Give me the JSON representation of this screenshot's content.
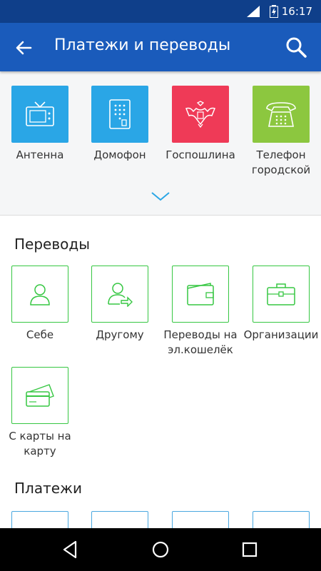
{
  "status": {
    "time": "16:17"
  },
  "appbar": {
    "title": "Платежи и переводы"
  },
  "top_tiles": [
    {
      "label": "Антенна",
      "color": "#2aa6e6"
    },
    {
      "label": "Домофон",
      "color": "#2aa6e6"
    },
    {
      "label": "Госпошлина",
      "color": "#ef3a57"
    },
    {
      "label": "Телефон городской",
      "color": "#8cc73f"
    }
  ],
  "transfers": {
    "title": "Переводы",
    "items": [
      {
        "label": "Себе"
      },
      {
        "label": "Другому"
      },
      {
        "label": "Переводы на эл.кошелёк"
      },
      {
        "label": "Организации"
      },
      {
        "label": "С карты на карту"
      }
    ]
  },
  "payments": {
    "title": "Платежи"
  },
  "colors": {
    "accent_green": "#36c742",
    "accent_blue": "#4aa8e0",
    "appbar": "#1a5bbb",
    "statusbar": "#0f3f8a"
  }
}
